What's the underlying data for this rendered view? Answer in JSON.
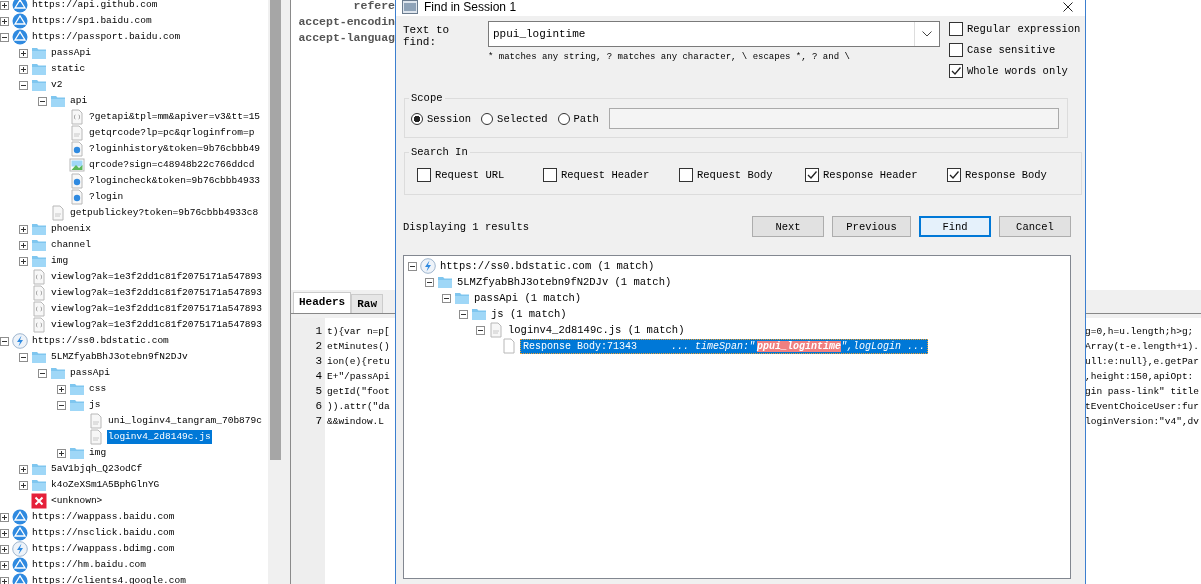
{
  "tree": [
    {
      "kind": "host",
      "label": "https://api.github.com",
      "expanded": false,
      "selected": false
    },
    {
      "kind": "host",
      "label": "https://sp1.baidu.com",
      "expanded": false,
      "selected": false
    },
    {
      "kind": "host",
      "label": "https://passport.baidu.com",
      "expanded": true,
      "selected": false,
      "children": [
        {
          "kind": "folder",
          "label": "passApi",
          "expanded": false,
          "selected": false
        },
        {
          "kind": "folder",
          "label": "static",
          "expanded": false,
          "selected": false
        },
        {
          "kind": "folder",
          "label": "v2",
          "expanded": true,
          "selected": false,
          "children": [
            {
              "kind": "folder",
              "label": "api",
              "expanded": true,
              "selected": false,
              "children": [
                {
                  "kind": "json",
                  "label": "?getapi&tpl=mm&apiver=v3&tt=15",
                  "selected": false
                },
                {
                  "kind": "js",
                  "label": "getqrcode?lp=pc&qrloginfrom=p",
                  "selected": false
                },
                {
                  "kind": "dot",
                  "label": "?loginhistory&token=9b76cbbb49",
                  "selected": false
                },
                {
                  "kind": "image",
                  "label": "qrcode?sign=c48948b22c766ddcd",
                  "selected": false
                },
                {
                  "kind": "dot",
                  "label": "?logincheck&token=9b76cbbb4933",
                  "selected": false
                },
                {
                  "kind": "dot",
                  "label": "?login",
                  "selected": false
                }
              ]
            },
            {
              "kind": "js",
              "label": "getpublickey?token=9b76cbbb4933c8",
              "selected": false
            }
          ]
        },
        {
          "kind": "folder",
          "label": "phoenix",
          "expanded": false,
          "selected": false
        },
        {
          "kind": "folder",
          "label": "channel",
          "expanded": false,
          "selected": false
        },
        {
          "kind": "folder",
          "label": "img",
          "expanded": false,
          "selected": false
        },
        {
          "kind": "json",
          "label": "viewlog?ak=1e3f2dd1c81f2075171a547893",
          "selected": false
        },
        {
          "kind": "json",
          "label": "viewlog?ak=1e3f2dd1c81f2075171a547893",
          "selected": false
        },
        {
          "kind": "json",
          "label": "viewlog?ak=1e3f2dd1c81f2075171a547893",
          "selected": false
        },
        {
          "kind": "json",
          "label": "viewlog?ak=1e3f2dd1c81f2075171a547893",
          "selected": false
        }
      ]
    },
    {
      "kind": "host-bolt",
      "label": "https://ss0.bdstatic.com",
      "expanded": true,
      "selected": false,
      "children": [
        {
          "kind": "folder",
          "label": "5LMZfyabBhJ3otebn9fN2DJv",
          "expanded": true,
          "selected": false,
          "children": [
            {
              "kind": "folder",
              "label": "passApi",
              "expanded": true,
              "selected": false,
              "children": [
                {
                  "kind": "folder",
                  "label": "css",
                  "expanded": false,
                  "selected": false
                },
                {
                  "kind": "folder",
                  "label": "js",
                  "expanded": true,
                  "selected": false,
                  "children": [
                    {
                      "kind": "js",
                      "label": "uni_loginv4_tangram_70b879c",
                      "selected": false
                    },
                    {
                      "kind": "js",
                      "label": "loginv4_2d8149c.js",
                      "selected": true
                    }
                  ]
                },
                {
                  "kind": "folder",
                  "label": "img",
                  "expanded": false,
                  "selected": false
                }
              ]
            }
          ]
        },
        {
          "kind": "folder",
          "label": "5aV1bjqh_Q23odCf",
          "expanded": false,
          "selected": false
        },
        {
          "kind": "folder",
          "label": "k4oZeXSm1A5BphGlnYG",
          "expanded": false,
          "selected": false
        },
        {
          "kind": "error",
          "label": "<unknown>",
          "selected": false
        }
      ]
    },
    {
      "kind": "host",
      "label": "https://wappass.baidu.com",
      "expanded": false,
      "selected": false
    },
    {
      "kind": "host",
      "label": "https://nsclick.baidu.com",
      "expanded": false,
      "selected": false
    },
    {
      "kind": "host-bolt",
      "label": "https://wappass.bdimg.com",
      "expanded": false,
      "selected": false
    },
    {
      "kind": "host",
      "label": "https://hm.baidu.com",
      "expanded": false,
      "selected": false
    },
    {
      "kind": "host",
      "label": "https://clients4.google.com",
      "expanded": false,
      "selected": false
    }
  ],
  "detail": {
    "header_lines": [
      "refere",
      "accept-encodin",
      "accept-languag"
    ],
    "tabs": [
      {
        "label": "Headers",
        "selected": true
      },
      {
        "label": "Raw",
        "selected": false
      }
    ],
    "code_lines": [
      {
        "number": "1",
        "left": "t){var n=p[",
        "right": "g=0,h=u.length;h>g;"
      },
      {
        "number": "2",
        "left": "etMinutes()",
        "right": "Array(t-e.length+1)."
      },
      {
        "number": "3",
        "left": "ion(e){retu",
        "right": "ull:e:null},e.getPar"
      },
      {
        "number": "4",
        "left": "E+\"/passApi",
        "right": ",height:150,apiOpt:"
      },
      {
        "number": "5",
        "left": "getId(\"foot",
        "right": "gin pass-link\" title"
      },
      {
        "number": "6",
        "left": ")).attr(\"da",
        "right": "tEventChoiceUser:fur"
      },
      {
        "number": "7",
        "left": "&&window.L",
        "right": "loginVersion:\"v4\",dv"
      }
    ]
  },
  "dialog": {
    "title": "Find in Session 1",
    "find_label": "Text to find:",
    "find_value": "ppui_logintime",
    "hint": "* matches any string, ? matches any character, \\ escapes *, ? and \\",
    "options": [
      {
        "label": "Regular expression",
        "checked": false
      },
      {
        "label": "Case sensitive",
        "checked": false
      },
      {
        "label": "Whole words only",
        "checked": true
      }
    ],
    "scope": {
      "title": "Scope",
      "options": [
        {
          "label": "Session",
          "selected": true
        },
        {
          "label": "Selected",
          "selected": false
        },
        {
          "label": "Path",
          "selected": false
        }
      ]
    },
    "search_in": {
      "title": "Search In",
      "options": [
        {
          "label": "Request URL",
          "checked": false
        },
        {
          "label": "Request Header",
          "checked": false
        },
        {
          "label": "Request Body",
          "checked": false
        },
        {
          "label": "Response Header",
          "checked": true
        },
        {
          "label": "Response Body",
          "checked": true
        }
      ]
    },
    "status": "Displaying 1 results",
    "buttons": [
      {
        "label": "Next",
        "default": false
      },
      {
        "label": "Previous",
        "default": false
      },
      {
        "label": "Find",
        "default": true
      },
      {
        "label": "Cancel",
        "default": false
      }
    ],
    "results": [
      {
        "kind": "host-bolt",
        "label": "https://ss0.bdstatic.com (1 match)",
        "expanded": true,
        "selected": false,
        "children": [
          {
            "kind": "folder",
            "label": "5LMZfyabBhJ3otebn9fN2DJv (1 match)",
            "expanded": true,
            "selected": false,
            "children": [
              {
                "kind": "folder",
                "label": "passApi (1 match)",
                "expanded": true,
                "selected": false,
                "children": [
                  {
                    "kind": "folder",
                    "label": "js (1 match)",
                    "expanded": true,
                    "selected": false,
                    "children": [
                      {
                        "kind": "js",
                        "label": "loginv4_2d8149c.js (1 match)",
                        "expanded": true,
                        "selected": false,
                        "children": [
                          {
                            "kind": "match",
                            "location": "Response Body:71343",
                            "before": "...   timeSpan:\"",
                            "match": "ppui_logintime",
                            "after": "\",logLogin  ...",
                            "selected": true
                          }
                        ]
                      }
                    ]
                  }
                ]
              }
            ]
          }
        ]
      }
    ]
  }
}
